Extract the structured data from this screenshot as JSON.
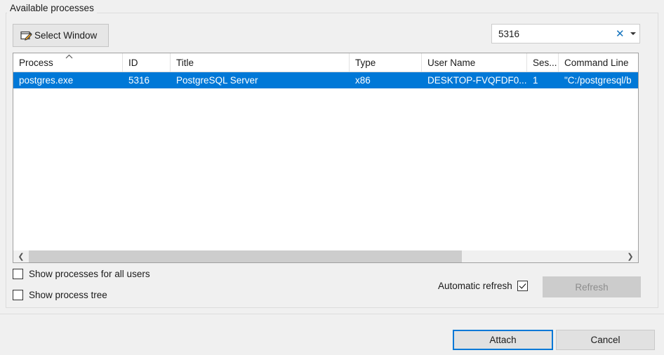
{
  "colors": {
    "selection_blue": "#0078D7",
    "accent_blue": "#1272BD",
    "dialog_background": "#F0F0F0",
    "list_background": "#FFFFFF",
    "disabled_gray": "#CCCCCC",
    "disabled_text": "#8D8D8D"
  },
  "groupbox": {
    "label": "Available processes"
  },
  "toolbar": {
    "select_window_label": "Select Window",
    "select_window_icon": "select-window-icon"
  },
  "search": {
    "value": "5316",
    "placeholder": "",
    "clear_icon": "clear-x-icon",
    "dropdown_icon": "chevron-down-icon"
  },
  "list": {
    "columns": [
      {
        "key": "process",
        "label": "Process",
        "sorted": true,
        "sort_direction": "ascending"
      },
      {
        "key": "id",
        "label": "ID",
        "sorted": false
      },
      {
        "key": "title",
        "label": "Title",
        "sorted": false
      },
      {
        "key": "type",
        "label": "Type",
        "sorted": false
      },
      {
        "key": "user_name",
        "label": "User Name",
        "sorted": false
      },
      {
        "key": "session",
        "label": "Ses...",
        "sorted": false
      },
      {
        "key": "command_line",
        "label": "Command Line",
        "sorted": false
      }
    ],
    "rows": [
      {
        "process": "postgres.exe",
        "id": "5316",
        "title": "PostgreSQL Server",
        "type": "x86",
        "user_name": "DESKTOP-FVQFDF0...",
        "session": "1",
        "command_line": "\"C:/postgresql/b",
        "selected": true
      }
    ],
    "scrollbar": {
      "left_arrow_icon": "chevron-left-icon",
      "right_arrow_icon": "chevron-right-icon"
    }
  },
  "options": {
    "show_all_users": {
      "label": "Show processes for all users",
      "checked": false
    },
    "show_process_tree": {
      "label": "Show process tree",
      "checked": false
    },
    "automatic_refresh": {
      "label": "Automatic refresh",
      "checked": true
    }
  },
  "buttons": {
    "refresh": {
      "label": "Refresh",
      "enabled": false
    },
    "attach": {
      "label": "Attach",
      "default": true
    },
    "cancel": {
      "label": "Cancel",
      "default": false
    }
  }
}
